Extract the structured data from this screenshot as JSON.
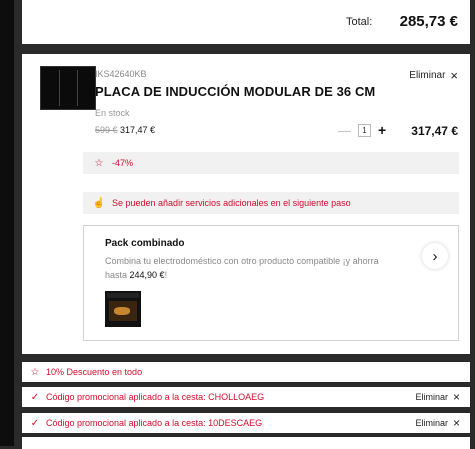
{
  "summary": {
    "total_label": "Total:",
    "total_value": "285,73 €"
  },
  "product": {
    "sku": "IKS42640KB",
    "title": "PLACA DE INDUCCIÓN MODULAR DE 36 CM",
    "stock": "En stock",
    "old_price": "599 €",
    "price": "317,47 €",
    "remove_label": "Eliminar",
    "quantity": "1",
    "line_price": "317,47 €",
    "discount_badge": "-47%",
    "services_notice": "Se pueden añadir servicios adicionales en el siguiente paso"
  },
  "combo": {
    "title": "Pack combinado",
    "text": "Combina tu electrodoméstico con otro producto compatible ¡y ahorra hasta ",
    "amount": "244,90 €",
    "suffix": "!"
  },
  "promos": [
    {
      "text": "10% Descuento en todo",
      "icon": "star-icon"
    },
    {
      "text": "Código promocional aplicado a la cesta: CHOLLOAEG",
      "remove": "Eliminar",
      "icon": "check-icon"
    },
    {
      "text": "Código promocional aplicado a la cesta: 10DESCAEG",
      "remove": "Eliminar",
      "icon": "check-icon"
    }
  ],
  "colors": {
    "accent": "#d60c2c",
    "background": "#2a2a2a",
    "card": "#ffffff"
  }
}
